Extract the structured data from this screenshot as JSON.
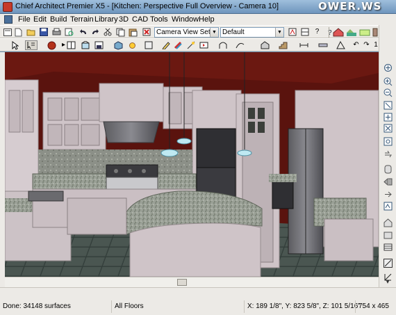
{
  "window": {
    "title": "Chief Architect Premier X5 - [Kitchen: Perspective Full Overview - Camera 10]",
    "watermark": "OWER.WS"
  },
  "menu": [
    "File",
    "Edit",
    "Build",
    "Terrain",
    "Library",
    "3D",
    "CAD",
    "Tools",
    "Window",
    "Help"
  ],
  "toolbar": {
    "camera_set_select": "Camera View Set",
    "default_select": "Default",
    "layer_number": "1"
  },
  "status": {
    "done": "Done:  34148 surfaces",
    "floors": "All Floors",
    "coords": "X: 189 1/8\", Y: 823 5/8\", Z: 101 5/16\"",
    "size": "754 x 465"
  },
  "icons": {
    "titlebar": [
      "app-icon"
    ],
    "toolbar1": [
      "menu-icon",
      "new-icon",
      "open-icon",
      "save-icon",
      "print-icon",
      "print-preview-icon",
      "undo-icon",
      "redo-icon",
      "cut-icon",
      "copy-icon",
      "paste-icon",
      "delete-icon",
      "camera-view-icon",
      "plan-view-icon",
      "layer-icon",
      "help-icon",
      "terrain-icon",
      "floor-icon",
      "wall-icon"
    ],
    "toolbar2": [
      "select-icon",
      "edit-mode-icon",
      "sphere-icon",
      "cabinet-icon",
      "window-icon",
      "door-icon",
      "fixture-icon",
      "light-icon",
      "paint-icon",
      "material-icon",
      "pencil-icon",
      "text-icon",
      "dimension-icon",
      "line-icon",
      "arc-icon",
      "box-icon",
      "roof-icon",
      "stair-icon",
      "plant-icon",
      "zoom-in-icon"
    ],
    "right": [
      "pan-icon",
      "zoom-in-icon",
      "zoom-out-icon",
      "fill-window-icon",
      "zoom-extents-icon",
      "rotate-icon",
      "orbit-icon",
      "walk-icon",
      "camera-icon",
      "view-icon",
      "door-open-icon",
      "wall-icon",
      "floor-icon",
      "layer-icon",
      "grid-icon",
      "line-icon",
      "pointer-icon"
    ]
  },
  "colors": {
    "accent": "#6e95bd",
    "wall": "#5c1410",
    "cabinet": "#c7bcc0",
    "granite": "#9fa59a",
    "floor": "#3b4743"
  }
}
